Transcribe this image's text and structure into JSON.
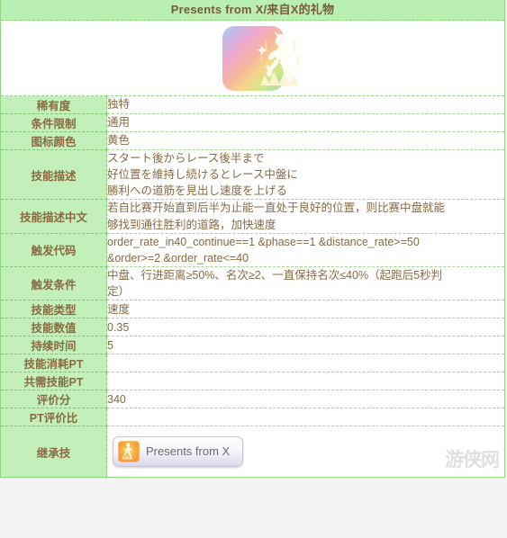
{
  "header": {
    "title": "Presents from X/来自X的礼物"
  },
  "icon": {
    "name": "skill-icon-running-figure",
    "border_colors": [
      "#a8d8f0",
      "#c4b6e8",
      "#efa8c8",
      "#f6b6a0",
      "#f5d78a",
      "#cbe88a",
      "#9fdcc0"
    ],
    "fill_colors": [
      "#ffc84d",
      "#ffa83a",
      "#fc8a3e",
      "#f87a44"
    ]
  },
  "rows": [
    {
      "label": "稀有度",
      "value": "独特"
    },
    {
      "label": "条件限制",
      "value": "通用"
    },
    {
      "label": "图标颜色",
      "value": "黄色"
    },
    {
      "label": "技能描述",
      "lines": [
        "スタート後からレース後半まで",
        "好位置を維持し続けるとレース中盤に",
        "勝利への道筋を見出し速度を上げる"
      ]
    },
    {
      "label": "技能描述中文",
      "lines": [
        "若自比赛开始直到后半为止能一直处于良好的位置，则比赛中盘就能",
        "够找到通往胜利的道路，加快速度"
      ]
    },
    {
      "label": "触发代码",
      "lines": [
        "order_rate_in40_continue==1 &phase==1 &distance_rate>=50",
        "&order>=2 &order_rate<=40"
      ]
    },
    {
      "label": "触发条件",
      "lines": [
        "中盘、行进距离≥50%、名次≥2、一直保持名次≤40%（起跑后5秒判",
        "定）"
      ]
    },
    {
      "label": "技能类型",
      "value": "速度"
    },
    {
      "label": "技能数值",
      "value": "0.35"
    },
    {
      "label": "持续时间",
      "value": "5"
    },
    {
      "label": "技能消耗PT",
      "value": ""
    },
    {
      "label": "共需技能PT",
      "value": ""
    },
    {
      "label": "评价分",
      "value": "340"
    },
    {
      "label": "PT评价比",
      "value": ""
    }
  ],
  "inherit": {
    "label": "继承技",
    "badge_text": "Presents from X"
  },
  "watermark": {
    "text": "游侠网"
  },
  "colors": {
    "label_bg": "#c3f0ba",
    "header_bg": "#b9efb0",
    "text": "#8a6a42",
    "border": "#8ed67f"
  }
}
